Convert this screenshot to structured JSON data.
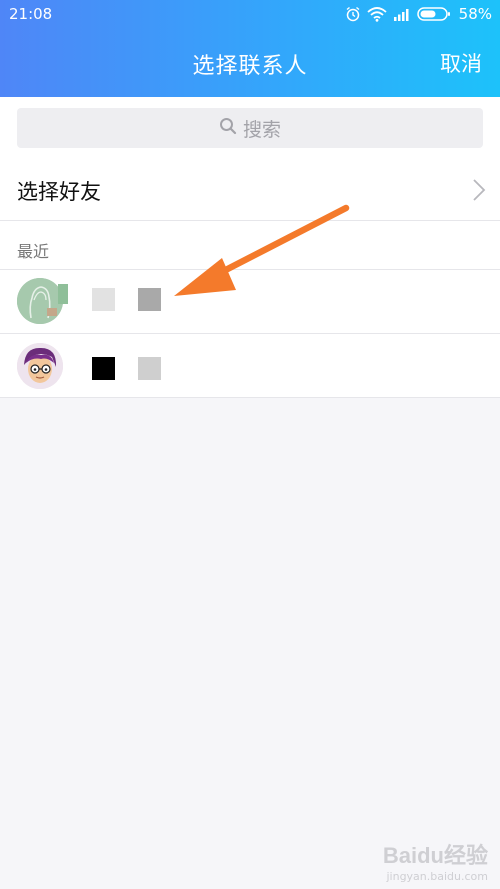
{
  "status_bar": {
    "time": "21:08",
    "battery": "58%",
    "icons": [
      "alarm-icon",
      "wifi-icon",
      "signal-icon",
      "battery-icon"
    ]
  },
  "nav": {
    "title": "选择联系人",
    "cancel": "取消"
  },
  "search": {
    "placeholder": "搜索"
  },
  "select_friends": {
    "label": "选择好友"
  },
  "recent": {
    "label": "最近",
    "contacts": [
      {
        "name": "",
        "avatar": "silhouette-avatar"
      },
      {
        "name": "",
        "avatar": "cartoon-avatar"
      }
    ]
  },
  "watermark": {
    "logo": "Baidu经验",
    "sub": "jingyan.baidu.com"
  },
  "colors": {
    "header_start": "#4f86f7",
    "header_end": "#1dc2fa",
    "arrow": "#f47a2b",
    "background": "#f6f6f9"
  }
}
